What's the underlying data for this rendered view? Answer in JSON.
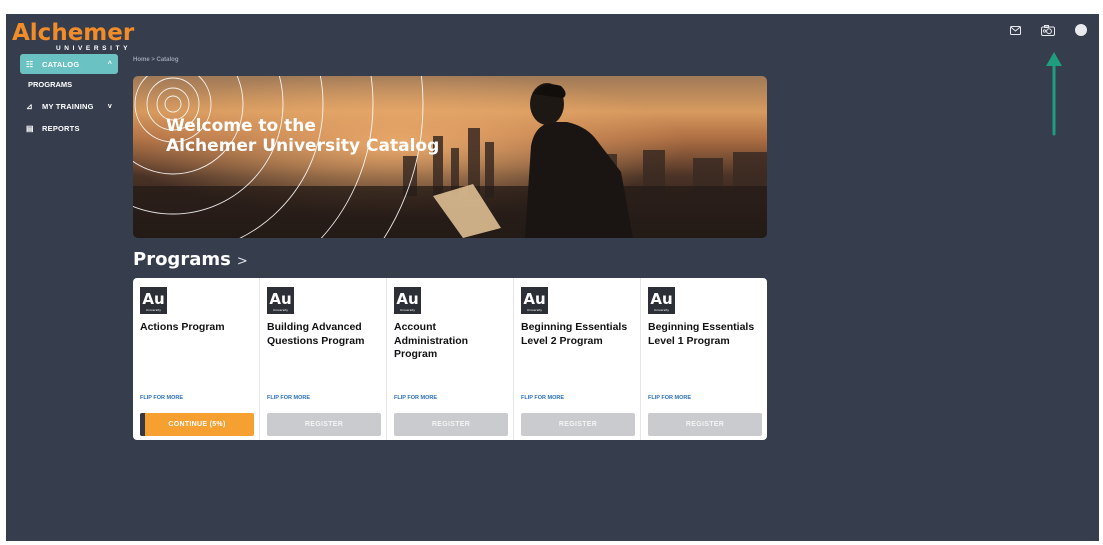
{
  "brand": {
    "name": "Alchemer",
    "sub": "UNIVERSITY"
  },
  "topbar": {
    "icons": [
      "mail-icon",
      "camera-icon",
      "avatar"
    ]
  },
  "sidebar": {
    "items": [
      {
        "label": "CATALOG",
        "icon": "catalog-icon",
        "active": true,
        "chevron": "^"
      },
      {
        "label": "PROGRAMS",
        "sub": true
      },
      {
        "label": "MY TRAINING",
        "icon": "chart-icon",
        "chevron": "v"
      },
      {
        "label": "REPORTS",
        "icon": "report-icon"
      }
    ]
  },
  "breadcrumb": "Home > Catalog",
  "hero": {
    "line1": "Welcome to the",
    "line2": "Alchemer University Catalog"
  },
  "programs": {
    "heading": "Programs",
    "arrow": ">",
    "cards": [
      {
        "logo": "Au",
        "logo_sub": "University",
        "title": "Actions Program",
        "flip": "FLIP FOR MORE",
        "button": "CONTINUE (5%)",
        "button_type": "continue"
      },
      {
        "logo": "Au",
        "logo_sub": "University",
        "title": "Building Advanced Questions Program",
        "flip": "FLIP FOR MORE",
        "button": "REGISTER",
        "button_type": "register"
      },
      {
        "logo": "Au",
        "logo_sub": "University",
        "title": "Account Administration Program",
        "flip": "FLIP FOR MORE",
        "button": "REGISTER",
        "button_type": "register"
      },
      {
        "logo": "Au",
        "logo_sub": "University",
        "title": "Beginning Essentials Level 2 Program",
        "flip": "FLIP FOR MORE",
        "button": "REGISTER",
        "button_type": "register"
      },
      {
        "logo": "Au",
        "logo_sub": "University",
        "title": "Beginning Essentials Level 1 Program",
        "flip": "FLIP FOR MORE",
        "button": "REGISTER",
        "button_type": "register"
      }
    ]
  },
  "colors": {
    "background": "#363e4d",
    "accent_teal": "#6bc2c3",
    "accent_orange": "#f28c28",
    "annotation": "#1f9e7f"
  }
}
